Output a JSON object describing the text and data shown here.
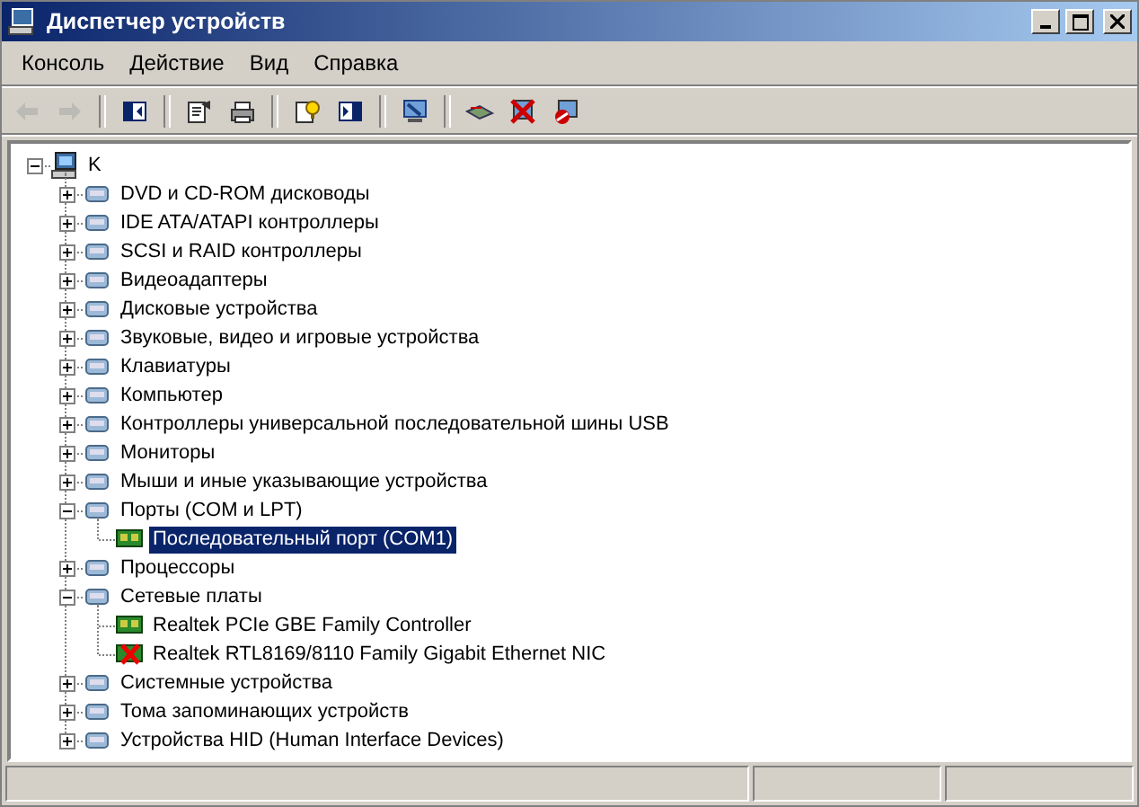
{
  "window": {
    "title": "Диспетчер устройств"
  },
  "menu": [
    {
      "label": "Консоль"
    },
    {
      "label": "Действие"
    },
    {
      "label": "Вид"
    },
    {
      "label": "Справка"
    }
  ],
  "toolbar": [
    {
      "kind": "button",
      "disabled": true
    },
    {
      "kind": "button",
      "disabled": true
    },
    {
      "kind": "separator"
    },
    {
      "kind": "button",
      "disabled": false
    },
    {
      "kind": "separator"
    },
    {
      "kind": "button",
      "disabled": false
    },
    {
      "kind": "button",
      "disabled": false
    },
    {
      "kind": "separator"
    },
    {
      "kind": "button",
      "disabled": false
    },
    {
      "kind": "button",
      "disabled": false
    },
    {
      "kind": "separator"
    },
    {
      "kind": "button",
      "disabled": false
    },
    {
      "kind": "separator"
    },
    {
      "kind": "button",
      "disabled": false
    },
    {
      "kind": "button",
      "disabled": false
    },
    {
      "kind": "button",
      "disabled": false
    }
  ],
  "tree": [
    {
      "label": "K",
      "expanded": true,
      "selected": false,
      "children": [
        {
          "label": "DVD и CD-ROM дисководы",
          "expanded": false,
          "selected": false
        },
        {
          "label": "IDE ATA/ATAPI контроллеры",
          "expanded": false,
          "selected": false
        },
        {
          "label": "SCSI и RAID контроллеры",
          "expanded": false,
          "selected": false
        },
        {
          "label": "Видеоадаптеры",
          "expanded": false,
          "selected": false
        },
        {
          "label": "Дисковые устройства",
          "expanded": false,
          "selected": false
        },
        {
          "label": "Звуковые, видео и игровые устройства",
          "expanded": false,
          "selected": false
        },
        {
          "label": "Клавиатуры",
          "expanded": false,
          "selected": false
        },
        {
          "label": "Компьютер",
          "expanded": false,
          "selected": false
        },
        {
          "label": "Контроллеры универсальной последовательной шины USB",
          "expanded": false,
          "selected": false
        },
        {
          "label": "Мониторы",
          "expanded": false,
          "selected": false
        },
        {
          "label": "Мыши и иные указывающие устройства",
          "expanded": false,
          "selected": false
        },
        {
          "label": "Порты (COM и LPT)",
          "expanded": true,
          "selected": false,
          "children": [
            {
              "label": "Последовательный порт (COM1)",
              "selected": true,
              "disabled": false
            }
          ]
        },
        {
          "label": "Процессоры",
          "expanded": false,
          "selected": false
        },
        {
          "label": "Сетевые платы",
          "expanded": true,
          "selected": false,
          "children": [
            {
              "label": "Realtek PCIe GBE Family Controller",
              "selected": false,
              "disabled": false
            },
            {
              "label": "Realtek RTL8169/8110 Family Gigabit Ethernet NIC",
              "selected": false,
              "disabled": true
            }
          ]
        },
        {
          "label": "Системные устройства",
          "expanded": false,
          "selected": false
        },
        {
          "label": "Тома запоминающих устройств",
          "expanded": false,
          "selected": false
        },
        {
          "label": "Устройства HID (Human Interface Devices)",
          "expanded": false,
          "selected": false
        }
      ]
    }
  ]
}
